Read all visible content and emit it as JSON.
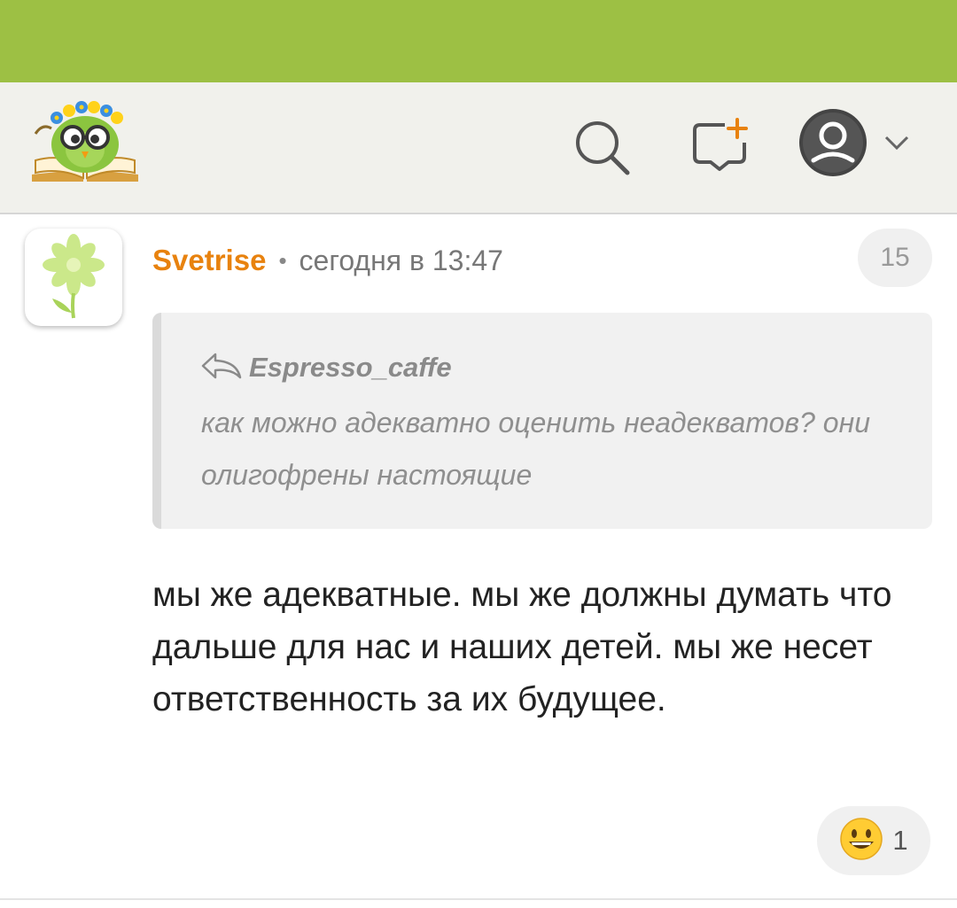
{
  "header": {
    "logo_icon": "owl-reading-book-logo",
    "search_icon": "search-icon",
    "new_message_icon": "new-message-icon",
    "profile_icon": "user-avatar-icon",
    "profile_chevron_icon": "chevron-down-icon"
  },
  "comment": {
    "avatar_icon": "green-flower-avatar",
    "author": "Svetrise",
    "separator": "•",
    "time": "сегодня в 13:47",
    "counter": "15",
    "quote": {
      "reply_icon": "reply-arrow-icon",
      "author": "Espresso_caffe",
      "text": "как можно адекватно оценить неадекватов? они олигофрены настоящие"
    },
    "text": "мы же адекватные. мы же должны думать что дальше для нас и наших детей. мы же несет ответственность за их будущее.",
    "reaction": {
      "icon": "grinning-emoji-icon",
      "count": "1"
    }
  },
  "colors": {
    "status_bar": "#9dc044",
    "header_bg": "#f1f1ec",
    "author": "#e8820e"
  }
}
